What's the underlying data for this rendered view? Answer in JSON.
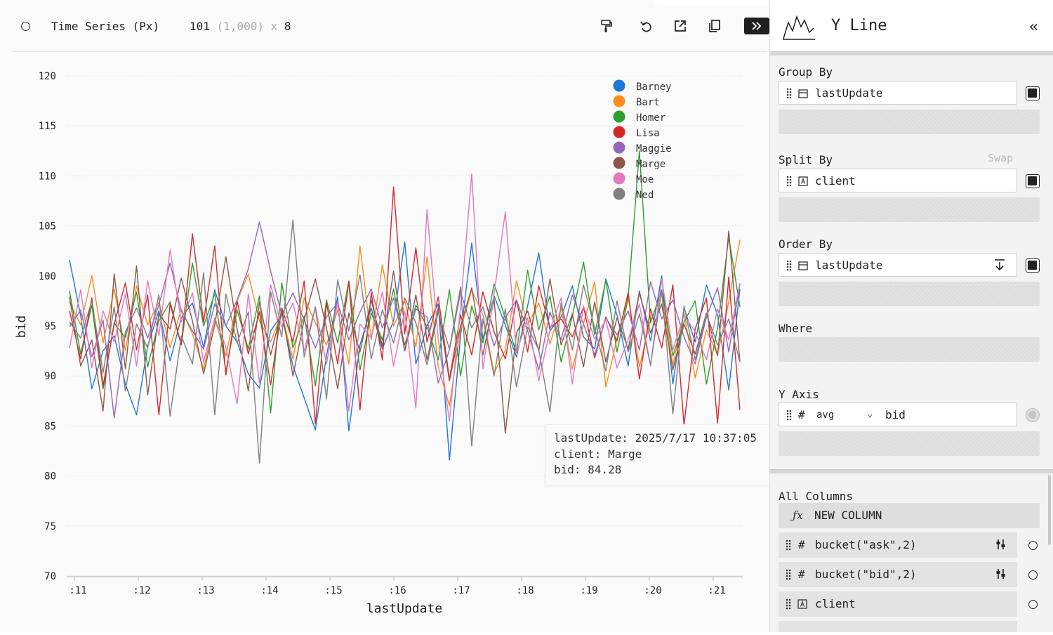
{
  "toolbar": {
    "title": "Time Series (Px)",
    "row_count": "101",
    "total_rows": "(1,000)",
    "times": "x",
    "column_count": "8",
    "icons": [
      "paint-roller-icon",
      "undo-icon",
      "export-icon",
      "copy-icon",
      "collapse-panel-icon"
    ]
  },
  "chart_data": {
    "type": "line",
    "xlabel": "lastUpdate",
    "ylabel": "bid",
    "ylim": [
      70,
      120
    ],
    "yticks": [
      "70",
      "75",
      "80",
      "85",
      "90",
      "95",
      "100",
      "105",
      "110",
      "115",
      "120"
    ],
    "xticks": [
      ":11",
      ":12",
      ":13",
      ":14",
      ":15",
      ":16",
      ":17",
      ":18",
      ":19",
      ":20",
      ":21"
    ],
    "legend_position": "top-right",
    "series": [
      {
        "name": "Barney",
        "color": "#1f77d4",
        "values": [
          101.6,
          96.0,
          88.7,
          92.5,
          94.0,
          89.2,
          86.1,
          93.0,
          96.5,
          91.5,
          95.8,
          97.3,
          92.9,
          98.6,
          95.0,
          93.4,
          90.2,
          88.8,
          94.5,
          96.1,
          91.0,
          87.8,
          84.6,
          92.0,
          97.9,
          84.5,
          93.1,
          96.8,
          92.7,
          95.5,
          103.4,
          91.2,
          95.0,
          97.2,
          81.6,
          94.0,
          103.3,
          93.7,
          98.0,
          95.1,
          91.9,
          97.0,
          102.3,
          94.5,
          95.9,
          99.0,
          93.9,
          92.7,
          99.7,
          96.1,
          91.0,
          98.5,
          93.5,
          100.0,
          89.2,
          96.8,
          93.4,
          99.1,
          96.1,
          88.6,
          98.7
        ]
      },
      {
        "name": "Bart",
        "color": "#ff8c1a",
        "values": [
          97.4,
          95.1,
          100.0,
          93.3,
          98.7,
          92.5,
          99.0,
          95.1,
          97.4,
          92.8,
          96.7,
          94.2,
          90.7,
          95.7,
          92.0,
          97.5,
          100.2,
          95.5,
          93.4,
          96.2,
          91.7,
          97.8,
          95.3,
          93.1,
          96.6,
          91.2,
          103.0,
          93.6,
          101.1,
          95.0,
          97.5,
          92.9,
          101.9,
          90.9,
          87.0,
          94.6,
          98.6,
          96.1,
          90.3,
          92.6,
          99.5,
          95.1,
          97.3,
          93.2,
          96.8,
          90.7,
          95.2,
          99.4,
          88.9,
          93.7,
          97.9,
          90.9,
          95.6,
          98.1,
          91.1,
          96.3,
          89.8,
          94.6,
          92.1,
          97.4,
          103.6
        ]
      },
      {
        "name": "Homer",
        "color": "#2ca02c",
        "values": [
          98.5,
          92.2,
          97.1,
          88.7,
          95.3,
          93.8,
          98.4,
          90.9,
          95.5,
          97.4,
          93.1,
          101.3,
          95.0,
          98.2,
          90.4,
          96.6,
          92.7,
          98.0,
          86.3,
          99.3,
          92.8,
          96.0,
          89.0,
          97.6,
          93.3,
          99.5,
          90.6,
          96.3,
          93.6,
          98.7,
          92.5,
          97.1,
          94.9,
          91.6,
          98.6,
          90.0,
          97.0,
          93.3,
          99.2,
          95.8,
          92.3,
          100.6,
          94.6,
          98.0,
          91.4,
          96.0,
          101.4,
          94.1,
          99.6,
          92.4,
          97.8,
          112.5,
          95.3,
          98.6,
          92.0,
          95.4,
          97.5,
          89.2,
          94.8,
          103.9,
          96.9
        ]
      },
      {
        "name": "Lisa",
        "color": "#d62728",
        "values": [
          96.5,
          91.7,
          97.8,
          89.0,
          95.2,
          99.3,
          92.6,
          98.1,
          86.1,
          97.2,
          93.1,
          104.2,
          95.4,
          103.0,
          90.1,
          97.5,
          92.2,
          96.4,
          89.1,
          96.8,
          93.4,
          99.5,
          85.2,
          97.3,
          91.2,
          99.4,
          86.6,
          98.3,
          91.6,
          108.9,
          94.2,
          102.8,
          93.4,
          97.9,
          89.7,
          96.1,
          92.1,
          98.4,
          94.4,
          91.7,
          97.6,
          92.4,
          99.0,
          94.8,
          95.7,
          93.9,
          96.9,
          91.8,
          95.9,
          93.5,
          98.3,
          89.7,
          96.7,
          92.8,
          99.1,
          85.1,
          94.7,
          97.8,
          85.3,
          99.9,
          86.6
        ]
      },
      {
        "name": "Maggie",
        "color": "#9467bd",
        "values": [
          94.9,
          96.6,
          91.9,
          95.6,
          85.8,
          94.4,
          96.8,
          93.8,
          97.1,
          101.3,
          96.5,
          94.5,
          92.7,
          97.2,
          95.0,
          97.6,
          100.7,
          105.4,
          100.5,
          96.1,
          98.3,
          95.6,
          92.8,
          95.9,
          97.3,
          93.6,
          96.4,
          98.7,
          94.8,
          97.8,
          93.1,
          96.7,
          95.9,
          89.3,
          92.6,
          98.4,
          94.8,
          96.9,
          93.0,
          95.8,
          97.6,
          94.5,
          90.6,
          96.4,
          93.6,
          98.1,
          95.2,
          92.1,
          95.8,
          94.1,
          96.5,
          92.6,
          99.4,
          95.7,
          97.6,
          93.9,
          91.2,
          95.9,
          98.8,
          92.4,
          99.2
        ]
      },
      {
        "name": "Marge",
        "color": "#8c564b",
        "values": [
          97.9,
          91.0,
          93.6,
          86.5,
          100.2,
          90.7,
          101.0,
          88.1,
          96.2,
          94.7,
          99.8,
          95.5,
          90.2,
          95.1,
          101.9,
          94.7,
          88.5,
          97.4,
          92.1,
          96.6,
          90.0,
          95.6,
          99.7,
          94.8,
          88.7,
          96.3,
          92.4,
          97.6,
          93.0,
          100.5,
          92.5,
          98.1,
          91.6,
          96.8,
          89.5,
          95.0,
          98.8,
          92.1,
          97.7,
          84.28,
          94.3,
          96.5,
          92.5,
          99.7,
          93.1,
          96.2,
          90.9,
          97.4,
          91.4,
          95.8,
          92.7,
          98.3,
          94.3,
          97.2,
          90.6,
          95.2,
          92.2,
          96.3,
          92.0,
          104.5,
          91.4
        ]
      },
      {
        "name": "Moe",
        "color": "#e377c2",
        "values": [
          92.8,
          98.6,
          90.8,
          96.5,
          93.4,
          98.2,
          91.0,
          99.5,
          94.0,
          102.6,
          95.4,
          98.3,
          91.4,
          95.8,
          92.9,
          87.2,
          98.2,
          89.3,
          99.1,
          94.9,
          97.3,
          92.5,
          96.9,
          91.2,
          97.4,
          86.5,
          95.2,
          93.8,
          98.4,
          91.0,
          96.5,
          86.8,
          106.6,
          93.7,
          85.5,
          97.0,
          110.2,
          90.7,
          98.2,
          106.4,
          92.3,
          95.8,
          89.5,
          94.6,
          97.8,
          89.2,
          97.0,
          93.7,
          95.6,
          90.8,
          93.6,
          97.2,
          91.0,
          99.7,
          92.6,
          96.1,
          94.4,
          91.6,
          96.7,
          93.6,
          99.3
        ]
      },
      {
        "name": "Ned",
        "color": "#7f7f7f",
        "values": [
          95.4,
          93.8,
          97.5,
          90.3,
          96.9,
          88.5,
          95.2,
          92.8,
          98.1,
          86.0,
          94.0,
          91.2,
          100.3,
          86.1,
          98.2,
          93.3,
          96.4,
          81.3,
          98.4,
          93.9,
          105.6,
          91.9,
          96.9,
          87.7,
          99.6,
          94.5,
          100.1,
          91.7,
          96.6,
          93.3,
          97.8,
          95.3,
          91.1,
          96.4,
          92.7,
          98.9,
          83.0,
          95.7,
          90.0,
          96.7,
          88.9,
          94.9,
          92.6,
          86.4,
          97.3,
          92.6,
          99.1,
          94.8,
          90.5,
          97.5,
          92.4,
          96.2,
          91.1,
          98.6,
          86.2,
          97.0,
          91.6,
          96.2,
          93.1,
          95.7,
          91.4
        ]
      }
    ]
  },
  "tooltip": {
    "line1": "lastUpdate: 2025/7/17 10:37:05",
    "line2": "client: Marge",
    "line3": "bid: 84.28"
  },
  "sidebar": {
    "plugin_name": "Y Line",
    "close_glyph": "«",
    "group_by": {
      "label": "Group By",
      "value": "lastUpdate",
      "type_icon": "calendar-icon"
    },
    "split_by": {
      "label": "Split By",
      "swap": "Swap",
      "value": "client",
      "type_icon": "string-type-icon"
    },
    "order_by": {
      "label": "Order By",
      "value": "lastUpdate",
      "type_icon": "calendar-icon",
      "sort_icon": "sort-desc-icon"
    },
    "where": {
      "label": "Where"
    },
    "y_axis": {
      "label": "Y Axis",
      "hash": "#",
      "agg": "avg",
      "chev": "⌄",
      "value": "bid"
    },
    "all_columns": {
      "label": "All Columns",
      "new_column": "NEW COLUMN",
      "fx": "ƒx",
      "columns": [
        {
          "hash": "#",
          "name": "bucket(\"ask\",2)"
        },
        {
          "hash": "#",
          "name": "bucket(\"bid\",2)"
        },
        {
          "hash": "",
          "name": "client"
        }
      ]
    }
  }
}
